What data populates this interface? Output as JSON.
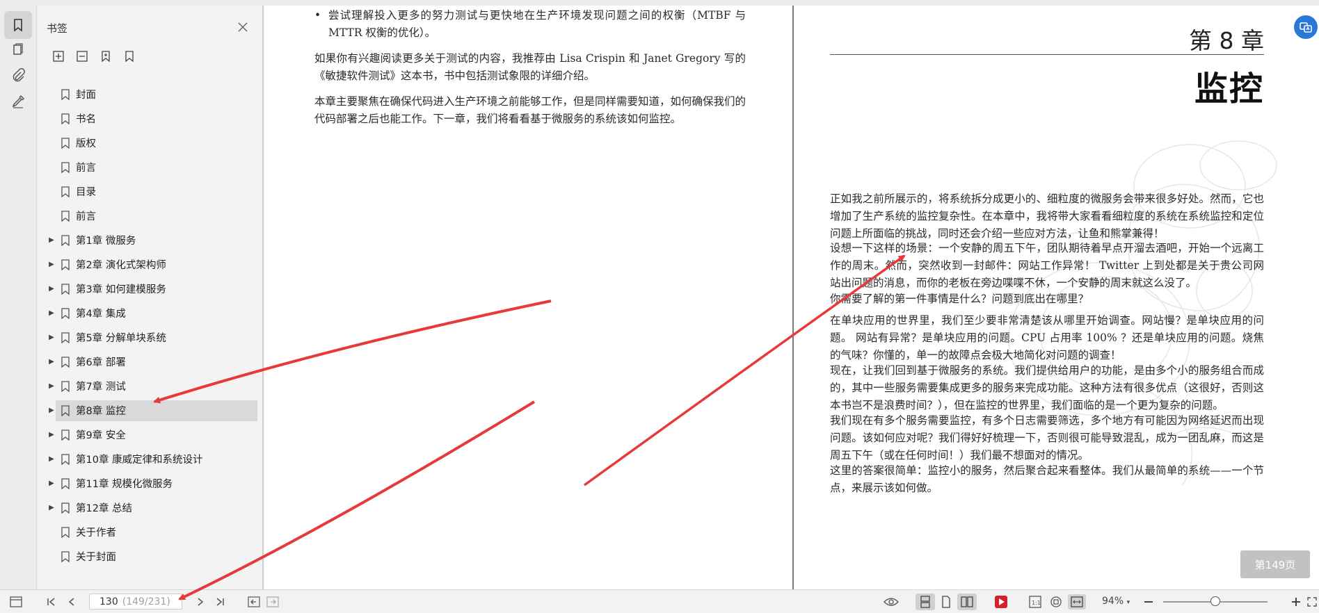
{
  "panel": {
    "title": "书签",
    "items": [
      {
        "label": "封面",
        "expandable": false
      },
      {
        "label": "书名",
        "expandable": false
      },
      {
        "label": "版权",
        "expandable": false
      },
      {
        "label": "前言",
        "expandable": false
      },
      {
        "label": "目录",
        "expandable": false
      },
      {
        "label": "前言",
        "expandable": false
      },
      {
        "label": "第1章 微服务",
        "expandable": true
      },
      {
        "label": "第2章 演化式架构师",
        "expandable": true
      },
      {
        "label": "第3章 如何建模服务",
        "expandable": true
      },
      {
        "label": "第4章 集成",
        "expandable": true
      },
      {
        "label": "第5章 分解单块系统",
        "expandable": true
      },
      {
        "label": "第6章 部署",
        "expandable": true
      },
      {
        "label": "第7章 测试",
        "expandable": true
      },
      {
        "label": "第8章 监控",
        "expandable": true,
        "selected": true
      },
      {
        "label": "第9章 安全",
        "expandable": true
      },
      {
        "label": "第10章 康威定律和系统设计",
        "expandable": true
      },
      {
        "label": "第11章 规模化微服务",
        "expandable": true
      },
      {
        "label": "第12章 总结",
        "expandable": true
      },
      {
        "label": "关于作者",
        "expandable": false
      },
      {
        "label": "关于封面",
        "expandable": false
      }
    ]
  },
  "left_page": {
    "bullet": "尝试理解投入更多的努力测试与更快地在生产环境发现问题之间的权衡（MTBF 与 MTTR 权衡的优化）。",
    "paragraphs": [
      "如果你有兴趣阅读更多关于测试的内容，我推荐由 Lisa Crispin 和 Janet Gregory 写的《敏捷软件测试》这本书，书中包括测试象限的详细介绍。",
      "本章主要聚焦在确保代码进入生产环境之前能够工作，但是同样需要知道，如何确保我们的代码部署之后也能工作。下一章，我们将看看基于微服务的系统该如何监控。"
    ]
  },
  "right_page": {
    "chapter_number": "第 8 章",
    "chapter_title": "监控",
    "paragraphs": [
      "正如我之前所展示的，将系统拆分成更小的、细粒度的微服务会带来很多好处。然而，它也增加了生产系统的监控复杂性。在本章中，我将带大家看看细粒度的系统在系统监控和定位问题上所面临的挑战，同时还会介绍一些应对方法，让鱼和熊掌兼得！",
      "设想一下这样的场景：一个安静的周五下午，团队期待着早点开溜去酒吧，开始一个远离工作的周末。然而，突然收到一封邮件：网站工作异常！ Twitter 上到处都是关于贵公司网站出问题的消息，而你的老板在旁边喋喋不休，一个安静的周末就这么没了。",
      "你需要了解的第一件事情是什么？问题到底出在哪里？",
      "在单块应用的世界里，我们至少要非常清楚该从哪里开始调查。网站慢？是单块应用的问题。 网站有异常？是单块应用的问题。CPU 占用率 100% ？还是单块应用的问题。烧焦的气味？你懂的，单一的故障点会极大地简化对问题的调查！",
      "现在，让我们回到基于微服务的系统。我们提供给用户的功能，是由多个小的服务组合而成的，其中一些服务需要集成更多的服务来完成功能。这种方法有很多优点（这很好，否则这本书岂不是浪费时间？），但在监控的世界里，我们面临的是一个更为复杂的问题。",
      "我们现在有多个服务需要监控，有多个日志需要筛选，多个地方有可能因为网络延迟而出现问题。该如何应对呢？我们得好好梳理一下，否则很可能导致混乱，成为一团乱麻，而这是周五下午（或在任何时间！）我们最不想面对的情况。",
      "这里的答案很简单：监控小的服务，然后聚合起来看整体。我们从最简单的系统——一个节点，来展示该如何做。"
    ],
    "page_badge": "第149页"
  },
  "bottom": {
    "page_current": "130",
    "page_total": "(149/231)",
    "zoom": "94%"
  },
  "icons": [
    "bookmark-icon",
    "pages-icon",
    "attachment-icon",
    "sign-icon",
    "close-icon",
    "expand-all-icon",
    "collapse-all-icon",
    "add-bookmark-icon",
    "bookmark-outline-icon",
    "sidebar-toggle-icon",
    "first-page-icon",
    "prev-page-icon",
    "next-page-icon",
    "last-page-icon",
    "back-icon",
    "forward-icon",
    "eye-icon",
    "translate-icon",
    "zoom-out-icon",
    "zoom-in-icon",
    "fullscreen-icon"
  ],
  "colors": {
    "accent": "#2a78d6",
    "annotation_arrow": "#e8393a",
    "play_red": "#d8202a"
  }
}
